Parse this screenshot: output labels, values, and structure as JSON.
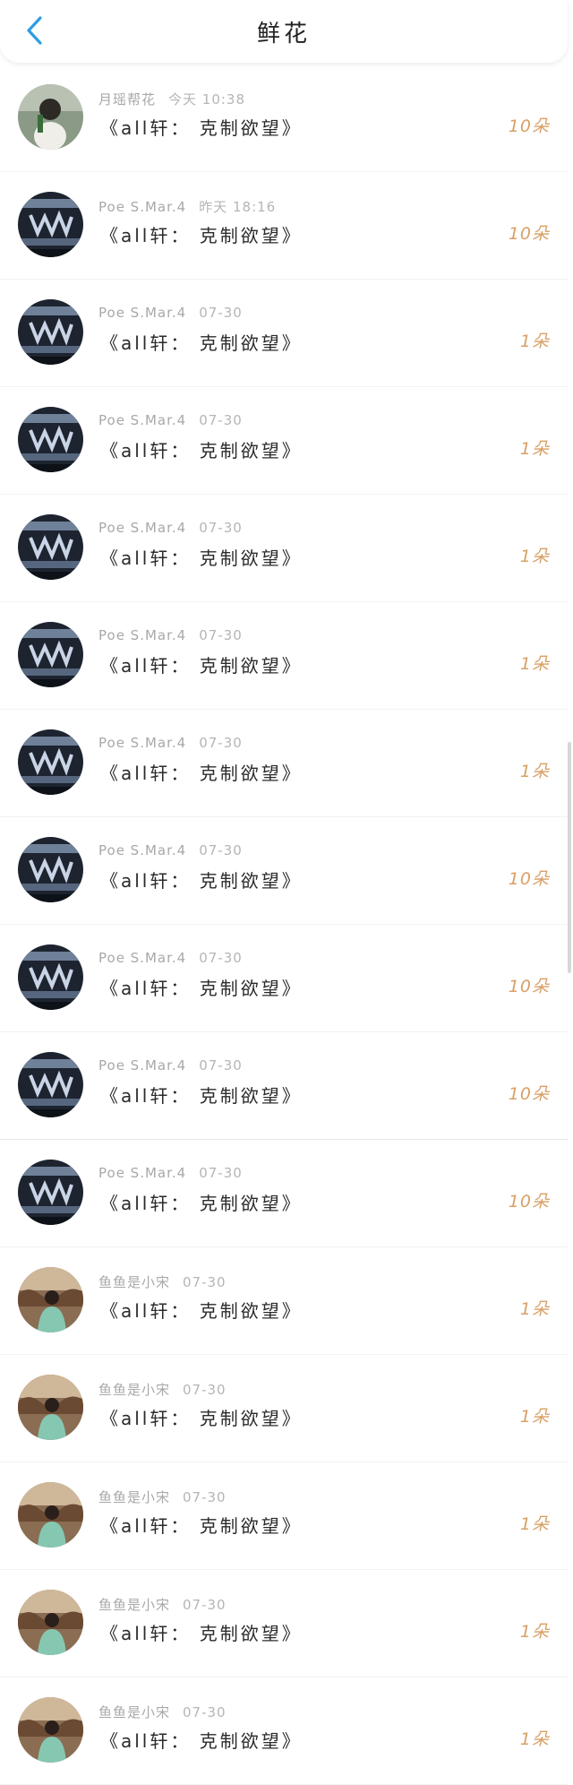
{
  "header": {
    "title": "鲜花"
  },
  "colors": {
    "back_arrow": "#2f9ce6",
    "count": "#d9a066"
  },
  "icons": {
    "back": "chevron-left-icon"
  },
  "rows": [
    {
      "user": "月瑶帮花",
      "time": "今天 10:38",
      "book": "《all轩： 克制欲望》",
      "count": "10朵",
      "avatar": "girl"
    },
    {
      "user": "Poe S.Mar.4",
      "time": "昨天 18:16",
      "book": "《all轩： 克制欲望》",
      "count": "10朵",
      "avatar": "stage"
    },
    {
      "user": "Poe S.Mar.4",
      "time": "07-30",
      "book": "《all轩： 克制欲望》",
      "count": "1朵",
      "avatar": "stage"
    },
    {
      "user": "Poe S.Mar.4",
      "time": "07-30",
      "book": "《all轩： 克制欲望》",
      "count": "1朵",
      "avatar": "stage"
    },
    {
      "user": "Poe S.Mar.4",
      "time": "07-30",
      "book": "《all轩： 克制欲望》",
      "count": "1朵",
      "avatar": "stage"
    },
    {
      "user": "Poe S.Mar.4",
      "time": "07-30",
      "book": "《all轩： 克制欲望》",
      "count": "1朵",
      "avatar": "stage"
    },
    {
      "user": "Poe S.Mar.4",
      "time": "07-30",
      "book": "《all轩： 克制欲望》",
      "count": "1朵",
      "avatar": "stage"
    },
    {
      "user": "Poe S.Mar.4",
      "time": "07-30",
      "book": "《all轩： 克制欲望》",
      "count": "10朵",
      "avatar": "stage"
    },
    {
      "user": "Poe S.Mar.4",
      "time": "07-30",
      "book": "《all轩： 克制欲望》",
      "count": "10朵",
      "avatar": "stage"
    },
    {
      "user": "Poe S.Mar.4",
      "time": "07-30",
      "book": "《all轩： 克制欲望》",
      "count": "10朵",
      "avatar": "stage"
    },
    {
      "user": "Poe S.Mar.4",
      "time": "07-30",
      "book": "《all轩： 克制欲望》",
      "count": "10朵",
      "avatar": "stage"
    },
    {
      "user": "鱼鱼是小宋",
      "time": "07-30",
      "book": "《all轩： 克制欲望》",
      "count": "1朵",
      "avatar": "field"
    },
    {
      "user": "鱼鱼是小宋",
      "time": "07-30",
      "book": "《all轩： 克制欲望》",
      "count": "1朵",
      "avatar": "field"
    },
    {
      "user": "鱼鱼是小宋",
      "time": "07-30",
      "book": "《all轩： 克制欲望》",
      "count": "1朵",
      "avatar": "field"
    },
    {
      "user": "鱼鱼是小宋",
      "time": "07-30",
      "book": "《all轩： 克制欲望》",
      "count": "1朵",
      "avatar": "field"
    },
    {
      "user": "鱼鱼是小宋",
      "time": "07-30",
      "book": "《all轩： 克制欲望》",
      "count": "1朵",
      "avatar": "field"
    }
  ]
}
